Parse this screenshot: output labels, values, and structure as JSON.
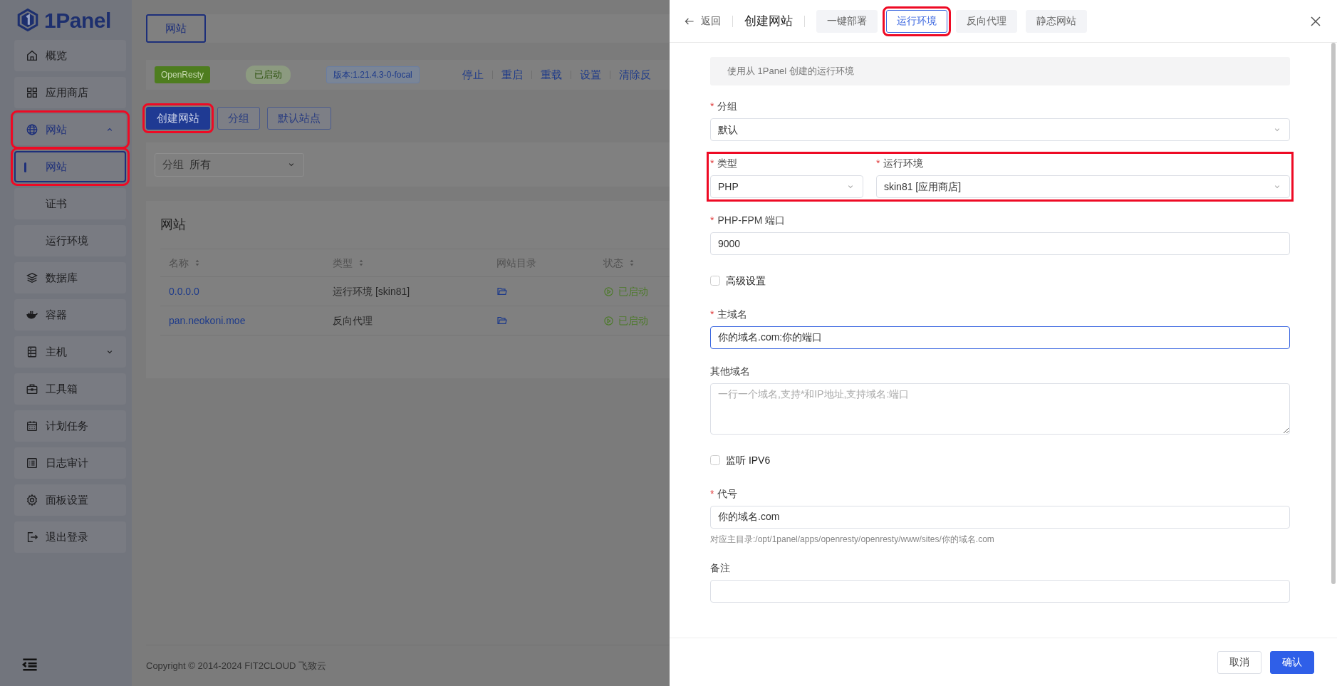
{
  "sidebar": {
    "logo": "1Panel",
    "items": [
      {
        "label": "概览",
        "kind": "link",
        "selected": false,
        "highlighted": false
      },
      {
        "label": "应用商店",
        "kind": "link",
        "selected": false,
        "highlighted": false
      },
      {
        "label": "网站",
        "kind": "group",
        "expanded": true,
        "highlighted": true,
        "children": [
          {
            "label": "网站",
            "selected": true,
            "highlighted": true
          },
          {
            "label": "证书",
            "selected": false,
            "highlighted": false
          },
          {
            "label": "运行环境",
            "selected": false,
            "highlighted": false
          }
        ]
      },
      {
        "label": "数据库",
        "kind": "link",
        "selected": false,
        "highlighted": false
      },
      {
        "label": "容器",
        "kind": "link",
        "selected": false,
        "highlighted": false
      },
      {
        "label": "主机",
        "kind": "group",
        "expanded": false,
        "highlighted": false
      },
      {
        "label": "工具箱",
        "kind": "link",
        "selected": false,
        "highlighted": false
      },
      {
        "label": "计划任务",
        "kind": "link",
        "selected": false,
        "highlighted": false
      },
      {
        "label": "日志审计",
        "kind": "link",
        "selected": false,
        "highlighted": false
      },
      {
        "label": "面板设置",
        "kind": "link",
        "selected": false,
        "highlighted": false
      },
      {
        "label": "退出登录",
        "kind": "link",
        "selected": false,
        "highlighted": false
      }
    ]
  },
  "main": {
    "tabs": [
      {
        "label": "网站",
        "selected": true
      }
    ],
    "app_status": {
      "app": "OpenResty",
      "status": "已启动",
      "version": "版本:1.21.4.3-0-focal",
      "actions": [
        "停止",
        "重启",
        "重载",
        "设置",
        "清除反"
      ]
    },
    "buttons": [
      {
        "label": "创建网站",
        "kind": "primary",
        "highlighted": true
      },
      {
        "label": "分组",
        "kind": "plain",
        "highlighted": false
      },
      {
        "label": "默认站点",
        "kind": "plain",
        "highlighted": false
      }
    ],
    "filter": {
      "label": "分组",
      "value": "所有"
    },
    "table": {
      "title": "网站",
      "columns": [
        {
          "label": "名称",
          "sortable": true
        },
        {
          "label": "类型",
          "sortable": true
        },
        {
          "label": "网站目录",
          "sortable": false
        },
        {
          "label": "状态",
          "sortable": true
        }
      ],
      "rows": [
        {
          "name": "0.0.0.0",
          "type": "运行环境 [skin81]",
          "status": "已启动"
        },
        {
          "name": "pan.neokoni.moe",
          "type": "反向代理",
          "status": "已启动"
        }
      ]
    },
    "footer": "Copyright © 2014-2024 FIT2CLOUD 飞致云"
  },
  "drawer": {
    "back": "返回",
    "title": "创建网站",
    "tabs": [
      {
        "label": "一键部署",
        "selected": false,
        "highlighted": false
      },
      {
        "label": "运行环境",
        "selected": true,
        "highlighted": true
      },
      {
        "label": "反向代理",
        "selected": false,
        "highlighted": false
      },
      {
        "label": "静态网站",
        "selected": false,
        "highlighted": false
      }
    ],
    "notice": "使用从 1Panel 创建的运行环境",
    "fields": [
      {
        "kind": "select",
        "mark": "*",
        "label": "分组",
        "value": "默认"
      },
      {
        "kind": "pair",
        "highlighted": true,
        "items": [
          {
            "mark": "*",
            "label": "类型",
            "value": "PHP"
          },
          {
            "mark": "*",
            "label": "运行环境",
            "value": "skin81 [应用商店]"
          }
        ]
      },
      {
        "kind": "input",
        "mark": "*",
        "label": "PHP-FPM 端口",
        "value": "9000",
        "focused": false
      },
      {
        "kind": "checkbox",
        "label": "高级设置",
        "checked": false
      },
      {
        "kind": "input",
        "mark": "*",
        "label": "主域名",
        "value": "你的域名.com:你的端口",
        "focused": true
      },
      {
        "kind": "textarea",
        "label": "其他域名",
        "placeholder": "一行一个域名,支持*和IP地址,支持域名:端口"
      },
      {
        "kind": "checkbox",
        "label": "监听 IPV6",
        "checked": false
      },
      {
        "kind": "input",
        "mark": "*",
        "label": "代号",
        "value": "你的域名.com",
        "focused": false,
        "help": "对应主目录:/opt/1panel/apps/openresty/openresty/www/sites/你的域名.com"
      },
      {
        "kind": "input",
        "label": "备注",
        "focused": false
      }
    ],
    "buttons": [
      {
        "label": "取消",
        "kind": "plain"
      },
      {
        "label": "确认",
        "kind": "primary"
      }
    ]
  }
}
